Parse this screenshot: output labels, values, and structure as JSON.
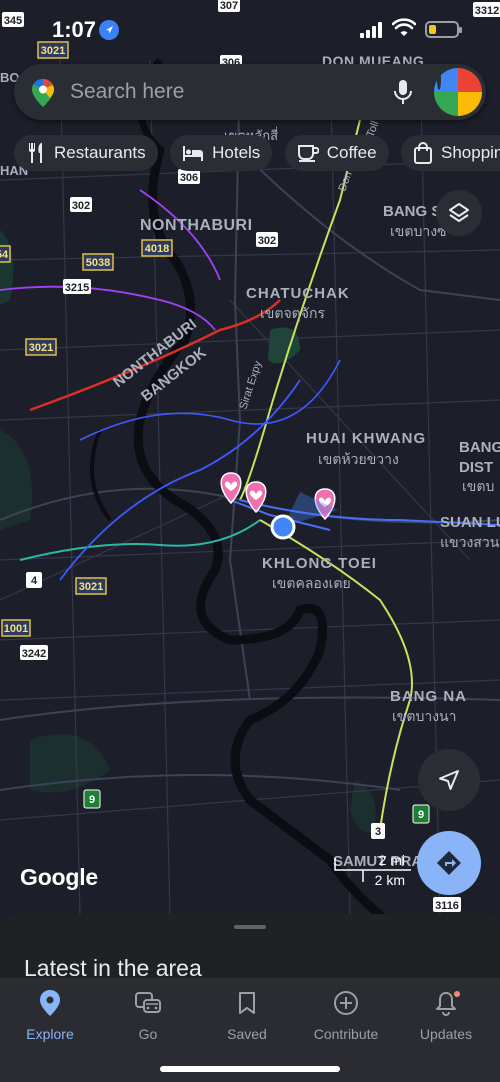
{
  "status_bar": {
    "time": "1:07"
  },
  "search": {
    "placeholder": "Search here"
  },
  "chips": [
    {
      "label": "Restaurants",
      "icon": "fork-knife-icon"
    },
    {
      "label": "Hotels",
      "icon": "bed-icon"
    },
    {
      "label": "Coffee",
      "icon": "coffee-cup-icon"
    },
    {
      "label": "Shopping",
      "icon": "shopping-bag-icon"
    }
  ],
  "map": {
    "place_labels": [
      {
        "key": "nonthaburi",
        "text": "NONTHABURI"
      },
      {
        "key": "chatuchak",
        "text": "CHATUCHAK"
      },
      {
        "key": "chatuchak_th",
        "text": "เขตจตุจักร"
      },
      {
        "key": "bang_sue",
        "text": "BANG S"
      },
      {
        "key": "bang_sue_th",
        "text": "เขตบางซ"
      },
      {
        "key": "huai_khwang",
        "text": "HUAI KHWANG"
      },
      {
        "key": "huai_khwang_th",
        "text": "เขตห้วยขวาง"
      },
      {
        "key": "bang_kapi",
        "text": "BANG"
      },
      {
        "key": "bang_kapi2",
        "text": "DIST"
      },
      {
        "key": "bang_kapi_th",
        "text": "เขตบ"
      },
      {
        "key": "suan_luang",
        "text": "SUAN LU"
      },
      {
        "key": "suan_luang_th",
        "text": "แขวงสวน"
      },
      {
        "key": "khlong_toei",
        "text": "KHLONG TOEI"
      },
      {
        "key": "khlong_toei_th",
        "text": "เขตคลองเตย"
      },
      {
        "key": "bang_na",
        "text": "BANG NA"
      },
      {
        "key": "bang_na_th",
        "text": "เขตบางนา"
      },
      {
        "key": "don_mueang",
        "text": "DON MUEANG"
      },
      {
        "key": "samut",
        "text": "SAMUT PRA"
      },
      {
        "key": "nonthaburi_border",
        "text": "NONTHABURI"
      },
      {
        "key": "bangkok_border",
        "text": "BANGKOK"
      },
      {
        "key": "lak_si_th",
        "text": "เขตหลักสี่"
      },
      {
        "key": "sirat_expy",
        "text": "Sirat Expy"
      },
      {
        "key": "don_road",
        "text": "Don"
      },
      {
        "key": "toll",
        "text": "Toll"
      },
      {
        "key": "bo",
        "text": "BO"
      },
      {
        "key": "han",
        "text": "HAN"
      }
    ],
    "road_shields": [
      {
        "key": "r345",
        "text": "345"
      },
      {
        "key": "r307",
        "text": "307"
      },
      {
        "key": "r3312",
        "text": "3312"
      },
      {
        "key": "r3021a",
        "text": "3021"
      },
      {
        "key": "r306a",
        "text": "306"
      },
      {
        "key": "r306b",
        "text": "306"
      },
      {
        "key": "r302a",
        "text": "302"
      },
      {
        "key": "r302b",
        "text": "302"
      },
      {
        "key": "r4018",
        "text": "4018"
      },
      {
        "key": "r5038",
        "text": "5038"
      },
      {
        "key": "r3215",
        "text": "3215"
      },
      {
        "key": "r3021b",
        "text": "3021"
      },
      {
        "key": "r3021c",
        "text": "3021"
      },
      {
        "key": "r4",
        "text": "4"
      },
      {
        "key": "r1001",
        "text": "1001"
      },
      {
        "key": "r3242",
        "text": "3242"
      },
      {
        "key": "r9a",
        "text": "9"
      },
      {
        "key": "r9b",
        "text": "9"
      },
      {
        "key": "r3",
        "text": "3"
      },
      {
        "key": "r3116",
        "text": "3116"
      },
      {
        "key": "r54",
        "text": "54"
      }
    ],
    "brand": "Google",
    "scale_top": "2 mi",
    "scale_bottom": "2 km",
    "saved_places": 3
  },
  "sheet": {
    "title": "Latest in the area"
  },
  "nav": [
    {
      "label": "Explore",
      "icon": "explore-pin-icon",
      "active": true
    },
    {
      "label": "Go",
      "icon": "car-bus-icon",
      "active": false
    },
    {
      "label": "Saved",
      "icon": "bookmark-icon",
      "active": false
    },
    {
      "label": "Contribute",
      "icon": "plus-circle-icon",
      "active": false
    },
    {
      "label": "Updates",
      "icon": "bell-icon",
      "active": false
    }
  ],
  "colors": {
    "map_bg": "#1c1f2a",
    "accent": "#8ab4f8",
    "heart_pin": "#f06fb0",
    "location_dot": "#4285f4",
    "river": "#0b0d12"
  }
}
